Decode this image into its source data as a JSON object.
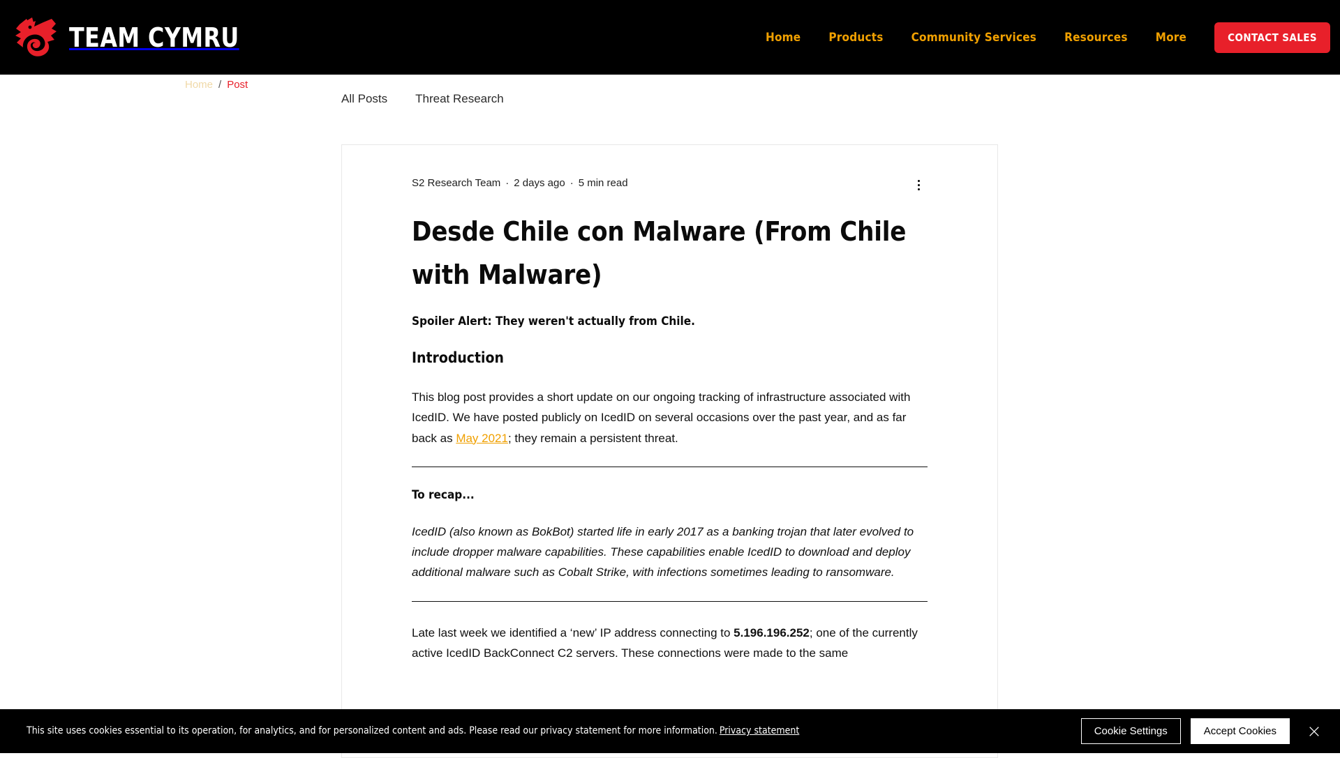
{
  "header": {
    "logo_text": "TEAM CYMRU",
    "logo_icon": "dragon-logo-icon",
    "nav": [
      {
        "label": "Home"
      },
      {
        "label": "Products"
      },
      {
        "label": "Community Services"
      },
      {
        "label": "Resources"
      },
      {
        "label": "More"
      }
    ],
    "cta_label": "CONTACT SALES",
    "brand_red": "#e8202a",
    "nav_orange": "#f0a000",
    "background": "#000000"
  },
  "breadcrumb": {
    "home": "Home",
    "separator": "/",
    "current": "Post"
  },
  "tabs": [
    {
      "label": "All Posts"
    },
    {
      "label": "Threat Research"
    }
  ],
  "post": {
    "author": "S2 Research Team",
    "dot1": "·",
    "date": "2 days ago",
    "dot2": "·",
    "read_time": "5 min read",
    "title": "Desde Chile con Malware (From Chile with Malware)",
    "lead": "Spoiler Alert: They weren't actually from Chile.",
    "heading_introduction": "Introduction",
    "intro_part1": "This blog post provides a short update on our ongoing tracking of infrastructure associated with IcedID. We have posted publicly on IcedID on several occasions over the past year, and as far back as ",
    "intro_link": "May 2021",
    "intro_part2": "; they remain a persistent threat.",
    "heading_recap": "To recap...",
    "recap_body": "IcedID (also known as BokBot) started life in early 2017 as a banking trojan that later evolved to include dropper malware capabilities. These capabilities enable IcedID to download and deploy additional malware such as Cobalt Strike, with infections sometimes leading to ransomware.",
    "closing_part1": "Late last week we identified a ‘new’ IP address connecting to ",
    "closing_ip": "5.196.196.252",
    "closing_part2": "; one of the currently active IcedID BackConnect C2 servers. These connections were made to the same"
  },
  "cookie_banner": {
    "text": "This site uses cookies essential to its operation, for analytics, and for personalized content and ads. Please read our privacy statement for more information.",
    "link_label": "Privacy statement",
    "settings_label": "Cookie Settings",
    "accept_label": "Accept Cookies",
    "close_icon": "close-icon"
  }
}
